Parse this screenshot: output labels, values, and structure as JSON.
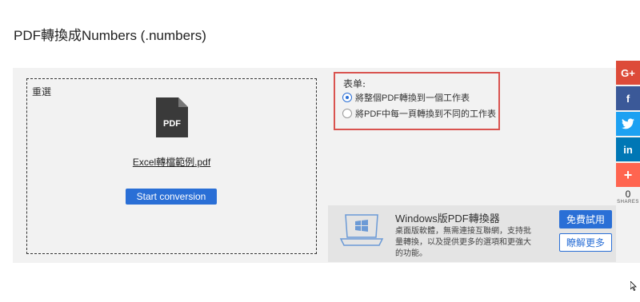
{
  "page": {
    "title": "PDF轉換成Numbers (.numbers)"
  },
  "upload": {
    "reselect_label": "重選",
    "file_name": "Excel轉檔範例.pdf",
    "icon_text": "PDF",
    "start_button": "Start conversion"
  },
  "form": {
    "label": "表单:",
    "options": [
      {
        "label": "將整個PDF轉換到一個工作表",
        "checked": true
      },
      {
        "label": "將PDF中每一頁轉換到不同的工作表",
        "checked": false
      }
    ]
  },
  "windows_promo": {
    "title": "Windows版PDF轉換器",
    "description": "桌面版軟體，無需連接互聯網，支持批量轉換，以及提供更多的選項和更強大的功能。",
    "try_button": "免費試用",
    "more_button": "瞭解更多"
  },
  "social": {
    "buttons": [
      {
        "name": "google-plus",
        "glyph": "G+",
        "color": "#dd4b39"
      },
      {
        "name": "facebook",
        "glyph": "f",
        "color": "#3b5998"
      },
      {
        "name": "twitter",
        "glyph": "🐦",
        "color": "#1da1f2"
      },
      {
        "name": "linkedin",
        "glyph": "in",
        "color": "#0077b5"
      },
      {
        "name": "more",
        "glyph": "+",
        "color": "#ff6550"
      }
    ],
    "count": "0",
    "shares_label": "SHARES"
  }
}
